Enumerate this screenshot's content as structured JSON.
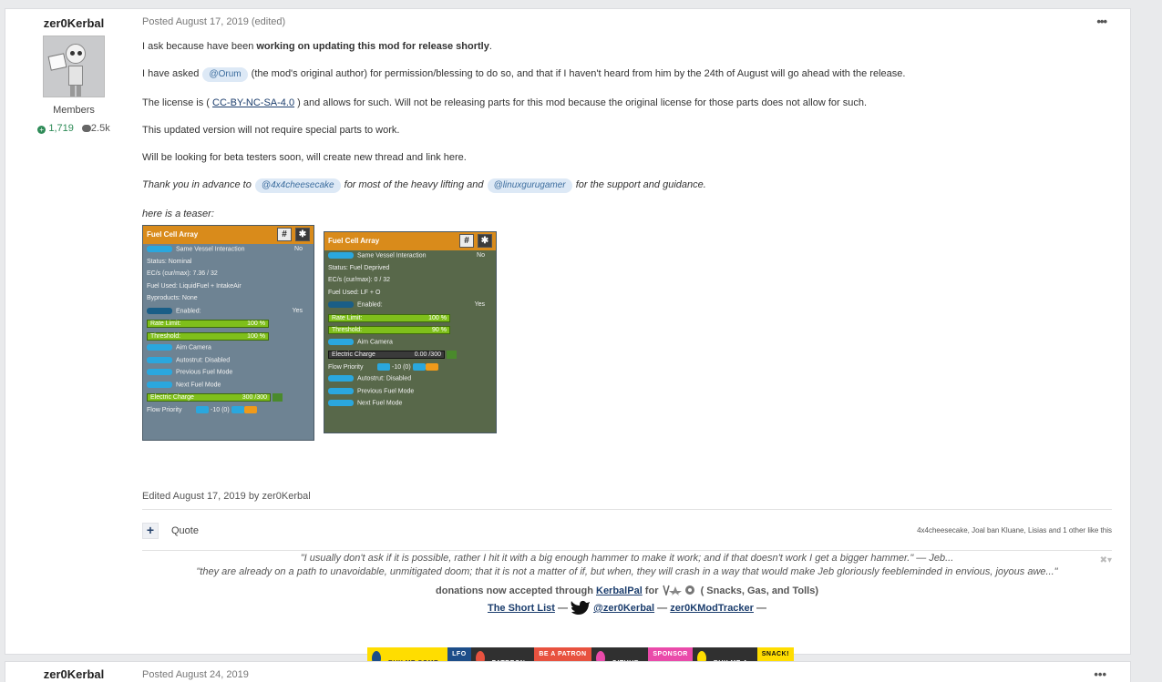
{
  "post1": {
    "author": "zer0Kerbal",
    "group": "Members",
    "reputation": "1,719",
    "posts": "2.5k",
    "meta": "Posted August 17, 2019 (edited)",
    "more": "•••",
    "p1_a": "I ask because have been ",
    "p1_b": "working on updating this mod for release shortly",
    "p1_c": ".",
    "p2_a": "I have asked ",
    "p2_mention": "@Orum",
    "p2_b": " (the mod's original author) for permission/blessing to do so, and that if I haven't heard from him by the 24th of August will go ahead with the release.",
    "p3_a": "The license is ( ",
    "p3_link": "CC-BY-NC-SA-4.0",
    "p3_b": " ) and allows for such. Will not be releasing parts for this mod because the original license for those parts does not allow for such.",
    "p4": "This updated version will not require special parts to work.",
    "p5": "Will be looking for beta testers soon, will create new thread and link here.",
    "p6_a": "Thank you in advance to ",
    "p6_mention1": "@4x4cheesecake",
    "p6_b": " for most of the heavy lifting and ",
    "p6_mention2": "@linuxgurugamer",
    "p6_c": " for the support and guidance.",
    "p7": "here is a teaser:",
    "edited": "Edited August 17, 2019 by zer0Kerbal",
    "quote": "Quote",
    "likes": "4x4cheesecake, Joal ban Kluane, Lisias and 1 other like this"
  },
  "panel1": {
    "title": "Fuel Cell Array",
    "hash": "#",
    "rows": {
      "svi": "Same Vessel Interaction",
      "svi_val": "No",
      "status": "Status: Nominal",
      "ec": "EC/s (cur/max): 7.36 / 32",
      "fuel": "Fuel Used: LiquidFuel + IntakeAir",
      "byp": "Byproducts: None",
      "enabled": "Enabled:",
      "enabled_val": "Yes",
      "rate": "Rate Limit:",
      "rate_val": "100 %",
      "thr": "Threshold:",
      "thr_val": "100 %",
      "aim": "Aim Camera",
      "auto": "Autostrut: Disabled",
      "prev": "Previous Fuel Mode",
      "next": "Next Fuel Mode",
      "elec": "Electric Charge",
      "elec_val": "300 /300",
      "flow": "Flow Priority",
      "flow_val": "-10   (0)"
    }
  },
  "panel2": {
    "title": "Fuel Cell Array",
    "hash": "#",
    "rows": {
      "svi": "Same Vessel Interaction",
      "svi_val": "No",
      "status": "Status: Fuel Deprived",
      "ec": "EC/s (cur/max): 0 / 32",
      "fuel": "Fuel Used: LF + O",
      "enabled": "Enabled:",
      "enabled_val": "Yes",
      "rate": "Rate Limit:",
      "rate_val": "100 %",
      "thr": "Threshold:",
      "thr_val": "90 %",
      "aim": "Aim Camera",
      "elec": "Electric Charge",
      "elec_val": "0.00 /300",
      "flow": "Flow Priority",
      "flow_val": "-10   (0)",
      "auto": "Autostrut: Disabled",
      "prev": "Previous Fuel Mode",
      "next": "Next Fuel Mode"
    }
  },
  "signature": {
    "quote1": "\"I usually don't ask if it is possible, rather I hit it with a big enough hammer to make it work; and if that doesn't work I get a bigger hammer.\"  — Jeb...",
    "quote2": "\"they are already on a path to unavoidable, unmitigated doom; that it is not a matter of if, but when, they will crash in a way that would make Jeb gloriously feebleminded in envious, joyous awe...\"",
    "don_a": "donations now accepted through ",
    "don_link": "KerbalPal",
    "don_b": " for ",
    "don_c": " ( Snacks, Gas, and Tolls)",
    "short_list": "The Short List",
    "dash1": " — ",
    "twitter": "@zer0Kerbal",
    "dash2": " — ",
    "tracker": "zer0KModTracker",
    "dash3": " —",
    "close": "✖▾",
    "badges": {
      "b1a": "BUY ME SOME",
      "b1b": "LFO",
      "b2a": "PATREON",
      "b2b": "BE A PATRON",
      "b3a": "GITHUB",
      "b3b": "SPONSOR",
      "b4a": "BUY ME A",
      "b4b": "SNACK!"
    }
  },
  "post2": {
    "author": "zer0Kerbal",
    "meta": "Posted August 24, 2019",
    "more": "•••"
  }
}
